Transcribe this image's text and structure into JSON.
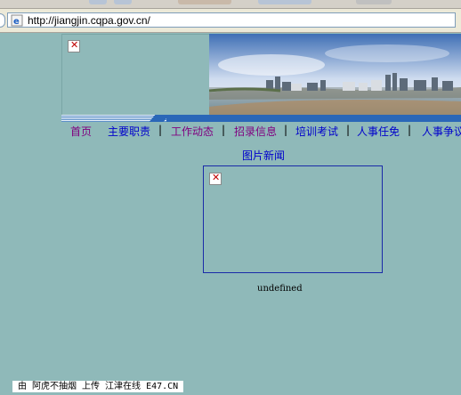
{
  "browser": {
    "url": "http://jiangjin.cqpa.gov.cn/"
  },
  "nav": {
    "items": [
      {
        "label": "首页",
        "visited": true
      },
      {
        "label": "主要职责",
        "visited": false
      },
      {
        "label": "工作动态",
        "visited": true
      },
      {
        "label": "招录信息",
        "visited": true
      },
      {
        "label": "培训考试",
        "visited": false
      },
      {
        "label": "人事任免",
        "visited": false
      },
      {
        "label": "人事争议",
        "visited": false
      }
    ],
    "separator": "|"
  },
  "photo_news": {
    "title": "图片新闻",
    "caption": "undefined"
  },
  "watermark": {
    "text": "由 阿虎不抽烟 上传 江津在线 E47.CN"
  },
  "colors": {
    "page_bg": "#8fb9b9",
    "link": "#0000cc",
    "link_visited": "#800080",
    "broken_x": "#c00000"
  }
}
